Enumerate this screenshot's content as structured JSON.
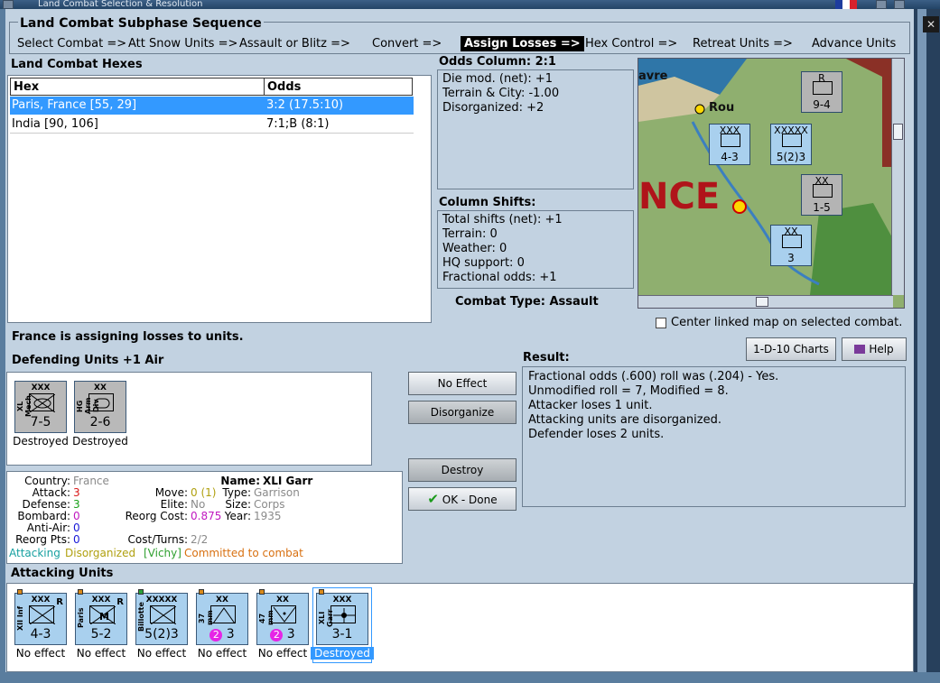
{
  "window": {
    "title": "Land Combat Selection & Resolution"
  },
  "sequence": {
    "title": "Land Combat Subphase Sequence",
    "steps": [
      "Select Combat =>",
      "Att Snow Units =>",
      "Assault or Blitz =>",
      "Convert =>",
      "Assign Losses =>",
      "Hex Control =>",
      "Retreat Units =>",
      "Advance Units"
    ],
    "active_index": 4
  },
  "hexes": {
    "title": "Land Combat Hexes",
    "headers": [
      "Hex",
      "Odds"
    ],
    "rows": [
      {
        "hex": "Paris, France [55, 29]",
        "odds": "3:2 (17.5:10)"
      },
      {
        "hex": "India [90, 106]",
        "odds": "7:1;B (8:1)"
      }
    ]
  },
  "odds_column": {
    "title": "Odds Column: 2:1",
    "lines": [
      "Die mod. (net): +1",
      "Terrain & City: -1.00",
      "Disorganized: +2"
    ]
  },
  "column_shifts": {
    "title": "Column Shifts:",
    "lines": [
      "Total shifts (net): +1",
      "Terrain: 0",
      "Weather: 0",
      "HQ support: 0",
      "Fractional odds: +1"
    ]
  },
  "combat_type": "Combat Type:  Assault",
  "map": {
    "label_havre": "avre",
    "label_rou": "Rou",
    "label_nce": "NCE",
    "units": [
      {
        "type": "XXX",
        "val": "4-3"
      },
      {
        "type": "XXXXX",
        "val": "5(2)3"
      },
      {
        "type": "XX",
        "val": "1-5"
      },
      {
        "type": "XX",
        "val": "3"
      },
      {
        "type": "R",
        "val": "9-4"
      }
    ]
  },
  "center_map_label": "Center linked map on selected combat.",
  "buttons": {
    "charts": "1-D-10 Charts",
    "help": "Help",
    "no_effect": "No Effect",
    "disorganize": "Disorganize",
    "destroy": "Destroy",
    "ok_done": "OK - Done"
  },
  "status_message": "France is assigning losses to units.",
  "defending": {
    "title": "Defending Units +1 Air",
    "units": [
      {
        "size": "XXX",
        "name": "XL Mech",
        "value": "7-5",
        "status": "Destroyed"
      },
      {
        "size": "XX",
        "name": "HG Arm Div",
        "value": "2-6",
        "status": "Destroyed"
      }
    ]
  },
  "details": {
    "country_label": "Country:",
    "country": "France",
    "attack_label": "Attack:",
    "attack": "3",
    "defense_label": "Defense:",
    "defense": "3",
    "bombard_label": "Bombard:",
    "bombard": "0",
    "antiair_label": "Anti-Air:",
    "antiair": "0",
    "reorgpts_label": "Reorg Pts:",
    "reorgpts": "0",
    "name_label": "Name:",
    "name": "XLI Garr",
    "move_label": "Move:",
    "move": "0 (1)",
    "type_label": "Type:",
    "type": "Garrison",
    "elite_label": "Elite:",
    "elite": "No",
    "size_label": "Size:",
    "size": "Corps",
    "reorgcost_label": "Reorg Cost:",
    "reorgcost": "0.875",
    "year_label": "Year:",
    "year": "1935",
    "costturns_label": "Cost/Turns:",
    "costturns": "2/2",
    "flag_attacking": "Attacking",
    "flag_disorganized": "Disorganized",
    "flag_vichy": "[Vichy]",
    "flag_committed": "Committed to combat"
  },
  "result": {
    "title": "Result:",
    "lines": [
      "Fractional odds (.600) roll was (.204)  - Yes.",
      "Unmodified roll = 7, Modified = 8.",
      "Attacker loses 1 unit.",
      "Attacking units are disorganized.",
      "Defender loses 2 units."
    ]
  },
  "attacking": {
    "title": "Attacking Units",
    "units": [
      {
        "size": "XXX",
        "name": "XII Inf",
        "tag": "R",
        "value": "4-3",
        "status": "No effect"
      },
      {
        "size": "XXX",
        "name": "Paris",
        "tag": "R",
        "value": "5-2",
        "status": "No effect"
      },
      {
        "size": "XXXXX",
        "name": "Billotte",
        "tag": "",
        "value": "5(2)3",
        "status": "No effect"
      },
      {
        "size": "XX",
        "name": "37 mm",
        "tag": "",
        "value": "2",
        "value2": "3",
        "status": "No effect"
      },
      {
        "size": "XX",
        "name": "47 mm",
        "tag": "",
        "value": "2",
        "value2": "3",
        "status": "No effect"
      },
      {
        "size": "XXX",
        "name": "XLI Garr",
        "tag": "",
        "value": "3-1",
        "status": "Destroyed"
      }
    ]
  },
  "colors": {
    "selection": "#3399ff",
    "attack_red": "#d81818",
    "defense_green": "#18a018",
    "bombard_magenta": "#c018c0",
    "antiair_blue": "#1818d8",
    "muted_grey": "#8a8a8a",
    "flag_teal": "#16a0a0",
    "flag_olive": "#b0a010",
    "flag_green": "#30a030",
    "flag_orange": "#d87010"
  }
}
